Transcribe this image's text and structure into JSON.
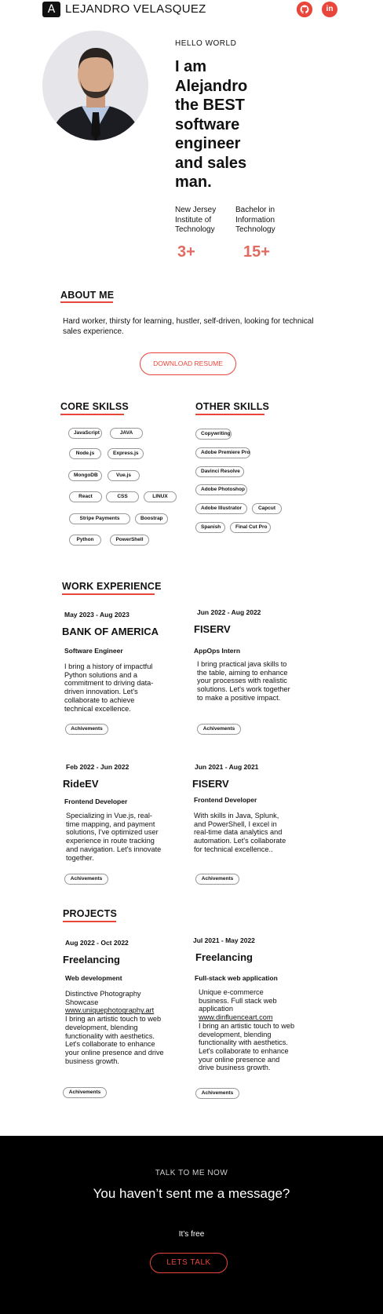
{
  "header": {
    "logo_letter": "A",
    "name": "LEJANDRO VELASQUEZ",
    "social": [
      {
        "icon": "github-icon",
        "glyph": "◉"
      },
      {
        "icon": "linkedin-icon",
        "glyph": "in"
      }
    ]
  },
  "hero": {
    "greeting": "HELLO WORLD",
    "headline": "I am Alejandro the BEST software engineer and sales man.",
    "education": [
      "New Jersey Institute of Technology",
      "Bachelor in Information Technology"
    ],
    "stats": [
      "3+",
      "15+"
    ]
  },
  "about": {
    "title": "ABOUT ME",
    "text": "Hard worker, thirsty for learning, hustler, self-driven, looking for technical sales experience.",
    "resume_button": "DOWNLOAD RESUME"
  },
  "core_skills": {
    "title": "CORE SKILSS",
    "items": [
      "JavaScript",
      "JAVA",
      "Node.js",
      "Express.js",
      "MongoDB",
      "Vue.js",
      "React",
      "CSS",
      "LINUX",
      "Stripe Payments",
      "Boostrap",
      "Python",
      "PowerShell"
    ]
  },
  "other_skills": {
    "title": "OTHER SKILLS",
    "items": [
      "Copywriting",
      "Adobe Premiere Pro",
      "Davinci Resolve",
      "Adobe Photoshop",
      "Adobe Illustrator",
      "Capcut",
      "Spanish",
      "Final Cut Pro"
    ]
  },
  "work": {
    "title": "WORK EXPERIENCE",
    "jobs": [
      {
        "date": "May 2023 - Aug 2023",
        "company": "BANK OF AMERICA",
        "role": "Software Engineer",
        "desc": "I bring a history of impactful Python solutions and a commitment to driving data-driven innovation. Let's collaborate to achieve technical excellence.",
        "button": "Achivements"
      },
      {
        "date": "Jun 2022 - Aug 2022",
        "company": "FISERV",
        "role": "AppOps Intern",
        "desc": "I bring practical java skills to the table, aiming to enhance your processes with realistic solutions. Let's work together to make a positive impact.",
        "button": "Achivements"
      },
      {
        "date": "Feb 2022 - Jun 2022",
        "company": "RideEV",
        "role": "Frontend Developer",
        "desc": "Specializing in Vue.js, real-time mapping, and payment solutions, I've optimized user experience in route tracking and navigation. Let's innovate together.",
        "button": "Achivements"
      },
      {
        "date": "Jun 2021 - Aug 2021",
        "company": "FISERV",
        "role": "Frontend Developer",
        "desc": "With skills in Java, Splunk, and PowerShell, I excel in real-time data analytics and automation. Let's collaborate for technical excellence..",
        "button": "Achivements"
      }
    ]
  },
  "projects": {
    "title": "PROJECTS",
    "items": [
      {
        "date": "Aug 2022 - Oct 2022",
        "name": "Freelancing",
        "role": "Web development",
        "intro": "Distinctive Photography Showcase",
        "link": "www.uniquephotography.art",
        "desc": "I bring an artistic touch to web development, blending functionality with aesthetics. Let's collaborate to enhance your online presence and drive business growth.",
        "button": "Achivements"
      },
      {
        "date": "Jul 2021 - May 2022",
        "name": "Freelancing",
        "role": "Full-stack web application",
        "intro": "Unique e-commerce business. Full stack web application",
        "link": "www.dinfluenceart.com",
        "desc": "I bring an artistic touch to web development, blending functionality with aesthetics. Let's collaborate to enhance your online presence and drive business growth.",
        "button": "Achivements"
      }
    ]
  },
  "footer": {
    "eyebrow": "TALK TO ME NOW",
    "headline": "You haven’t sent me a message?",
    "sub": "It’s free",
    "button": "LETS TALK"
  },
  "colors": {
    "accent": "#e8463b",
    "stat": "#e06b60",
    "footer_bg": "#000000"
  }
}
